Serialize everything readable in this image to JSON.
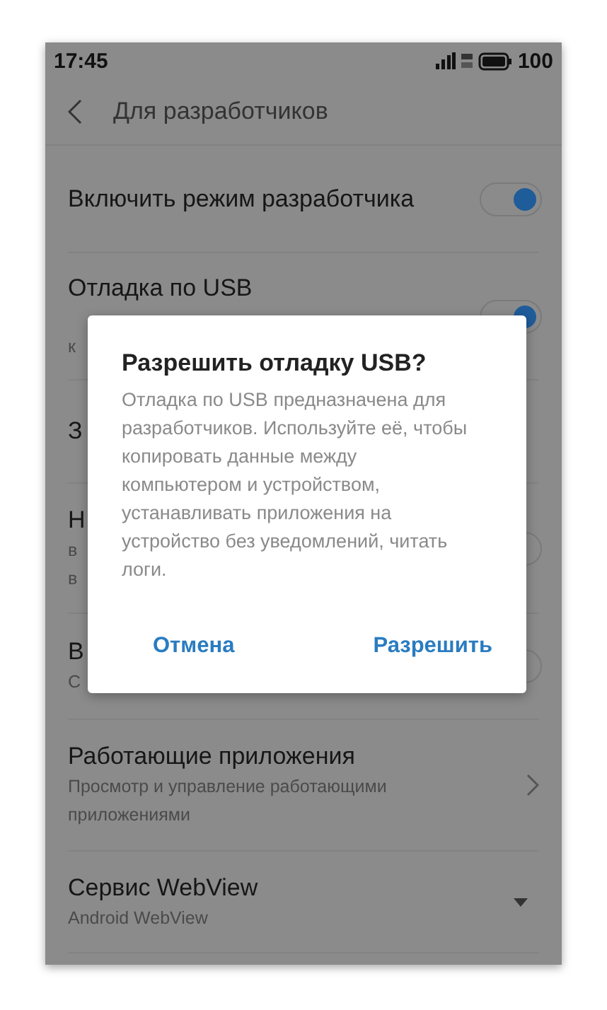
{
  "status_bar": {
    "time": "17:45",
    "battery": "100"
  },
  "header": {
    "title": "Для разработчиков"
  },
  "rows": [
    {
      "title": "Включить режим разработчика",
      "subtitle": [],
      "kind": "toggle",
      "on": true
    },
    {
      "title": "Отладка по USB",
      "subtitle": [
        "к"
      ],
      "kind": "toggle",
      "on": true
    },
    {
      "title": "З",
      "subtitle": []
    },
    {
      "title": "Н",
      "subtitle": [
        "в",
        "в"
      ],
      "kind": "toggle",
      "on": false
    },
    {
      "title": "В",
      "subtitle": [
        "С"
      ],
      "kind": "toggle",
      "on": false
    },
    {
      "title": "Работающие приложения",
      "subtitle": [
        "Просмотр и управление работающими",
        "приложениями"
      ],
      "kind": "chevron"
    },
    {
      "title": "Сервис WebView",
      "subtitle": [
        "Android WebView"
      ],
      "kind": "dropdown"
    }
  ],
  "dialog": {
    "title": "Разрешить отладку USB?",
    "message": "Отладка по USB предназначена для разработчиков. Используйте её, чтобы копировать данные между компьютером и устройством, устанавливать приложения на устройство без уведомлений, читать логи.",
    "buttons": [
      "Отмена",
      "Разрешить"
    ]
  }
}
